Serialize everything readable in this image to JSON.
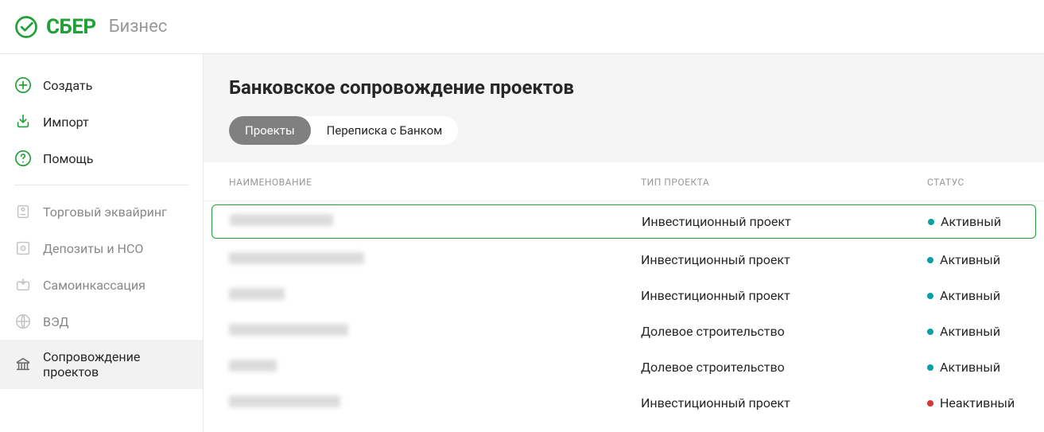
{
  "brand": {
    "name": "СБЕР",
    "suffix": "Бизнес"
  },
  "sidebar": {
    "primary": [
      {
        "label": "Создать"
      },
      {
        "label": "Импорт"
      },
      {
        "label": "Помощь"
      }
    ],
    "secondary": [
      {
        "label": "Торговый эквайринг"
      },
      {
        "label": "Депозиты и НСО"
      },
      {
        "label": "Самоинкассация"
      },
      {
        "label": "ВЭД"
      },
      {
        "label": "Сопровождение проектов"
      }
    ]
  },
  "page": {
    "title": "Банковское сопровождение проектов",
    "tabs": [
      {
        "label": "Проекты",
        "active": true
      },
      {
        "label": "Переписка с Банком",
        "active": false
      }
    ]
  },
  "table": {
    "headers": {
      "name": "НАИМЕНОВАНИЕ",
      "type": "ТИП ПРОЕКТА",
      "status": "СТАТУС"
    },
    "rows": [
      {
        "type": "Инвестиционный проект",
        "status": "Активный",
        "status_kind": "active",
        "selected": true
      },
      {
        "type": "Инвестиционный проект",
        "status": "Активный",
        "status_kind": "active",
        "selected": false
      },
      {
        "type": "Инвестиционный проект",
        "status": "Активный",
        "status_kind": "active",
        "selected": false
      },
      {
        "type": "Долевое строительство",
        "status": "Активный",
        "status_kind": "active",
        "selected": false
      },
      {
        "type": "Долевое строительство",
        "status": "Активный",
        "status_kind": "active",
        "selected": false
      },
      {
        "type": "Инвестиционный проект",
        "status": "Неактивный",
        "status_kind": "inactive",
        "selected": false
      }
    ]
  },
  "colors": {
    "brand_green": "#21A038",
    "status_active": "#08a0a5",
    "status_inactive": "#d63838"
  }
}
